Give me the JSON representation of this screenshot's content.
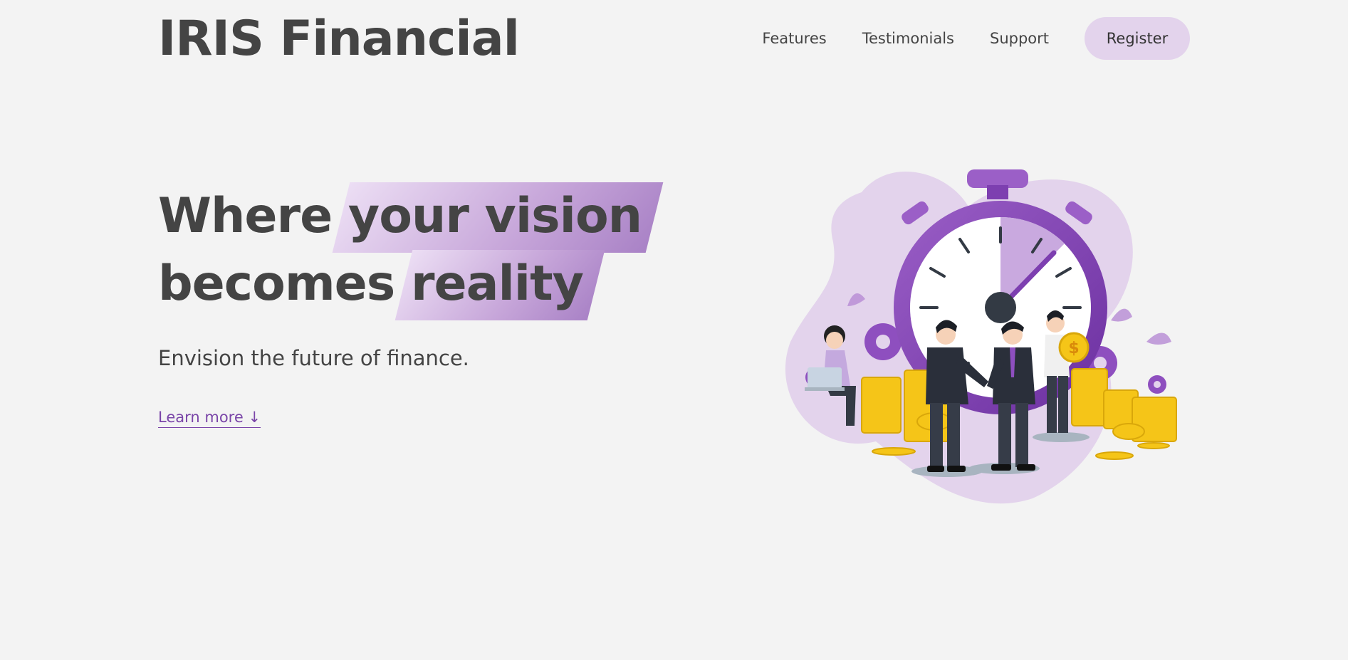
{
  "brand": {
    "name": "IRIS Financial"
  },
  "nav": {
    "links": [
      "Features",
      "Testimonials",
      "Support"
    ],
    "register_label": "Register"
  },
  "hero": {
    "title_line1_plain": "Where ",
    "title_line1_highlight": "your vision",
    "title_line2_plain": "becomes ",
    "title_line2_highlight": "reality",
    "subtitle": "Envision the future of finance.",
    "cta_label": "Learn more ↓"
  },
  "colors": {
    "background": "#f3f3f3",
    "text": "#444444",
    "accent": "#7a45a8",
    "register_bg": "#e3d3ec",
    "highlight_light": "#ecdef4",
    "highlight_dark": "#a982c6",
    "coin": "#f5c518"
  },
  "illustration": {
    "subject": "stopwatch with business people shaking hands, coin stacks",
    "coin_symbol": "$"
  }
}
